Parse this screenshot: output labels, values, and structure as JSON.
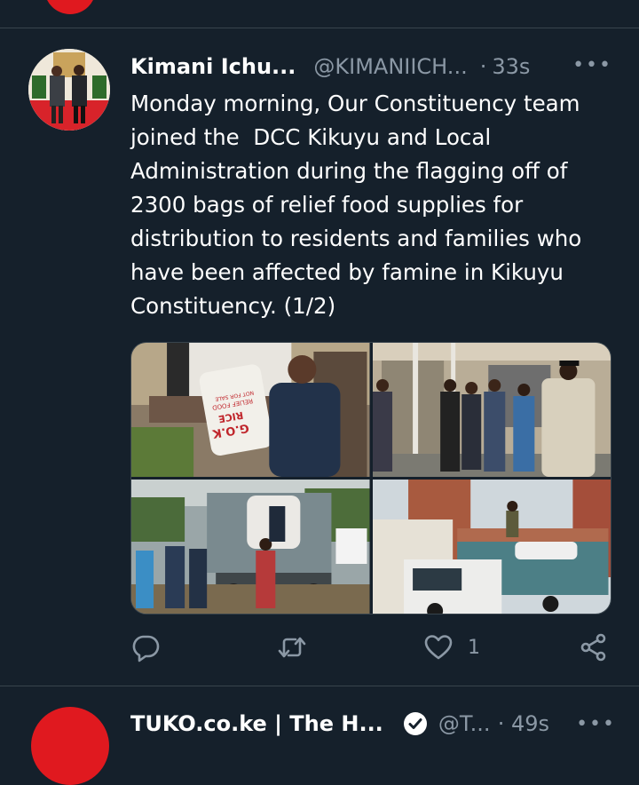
{
  "tweet": {
    "display_name": "Kimani Ichu...",
    "handle": "@KIMANIICH...",
    "separator": "·",
    "time": "33s",
    "more_label": "•••",
    "text": "Monday morning, Our Constituency team\njoined the  DCC Kikuyu and Local\nAdministration during the flagging off of\n2300 bags of relief food supplies for\ndistribution to residents and families who\nhave been affected by famine in Kikuyu\nConstituency. (1/2)",
    "bag_label_lines": [
      "G.O.K",
      "RICE",
      "RELIEF FOOD",
      "NOT FOR SALE"
    ],
    "actions": {
      "reply_icon": "reply-icon",
      "retweet_icon": "retweet-icon",
      "like_icon": "heart-icon",
      "like_count": "1",
      "share_icon": "share-icon"
    }
  },
  "next_tweet": {
    "display_name": "TUKO.co.ke | The H...",
    "handle": "@T...",
    "time": "· 49s",
    "more_label": "•••"
  },
  "colors": {
    "background": "#15202b",
    "divider": "#38444d",
    "secondary_text": "#8b98a5",
    "avatar_red": "#e0191f"
  }
}
